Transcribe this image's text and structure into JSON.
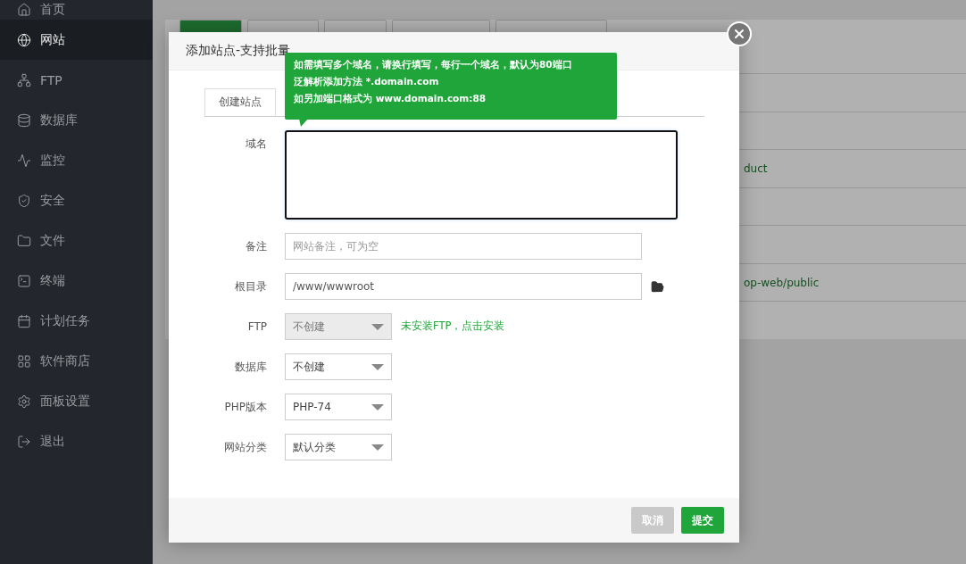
{
  "sidebar": {
    "items": [
      {
        "label": "首页",
        "selected": false
      },
      {
        "label": "网站",
        "selected": true
      },
      {
        "label": "FTP",
        "selected": false
      },
      {
        "label": "数据库",
        "selected": false
      },
      {
        "label": "监控",
        "selected": false
      },
      {
        "label": "安全",
        "selected": false
      },
      {
        "label": "文件",
        "selected": false
      },
      {
        "label": "终端",
        "selected": false
      },
      {
        "label": "计划任务",
        "selected": false
      },
      {
        "label": "软件商店",
        "selected": false
      },
      {
        "label": "面板设置",
        "selected": false
      },
      {
        "label": "退出",
        "selected": false
      }
    ]
  },
  "background_table": {
    "rows": [
      "",
      "",
      "duct",
      "",
      "",
      "op-web/public",
      ""
    ]
  },
  "dialog": {
    "title": "添加站点-支持批量",
    "tabs": [
      {
        "label": "创建站点",
        "selected": true
      }
    ],
    "tooltip": [
      "如需填写多个域名，请换行填写，每行一个域名，默认为80端口",
      "泛解析添加方法 *.domain.com",
      "如另加端口格式为 www.domain.com:88"
    ],
    "fields": [
      {
        "kind": "textarea",
        "label": "域名"
      },
      {
        "kind": "input",
        "label": "备注",
        "placeholder": "网站备注，可为空"
      },
      {
        "kind": "input",
        "label": "根目录",
        "value": "/www/wwwroot",
        "browse": true
      },
      {
        "kind": "select",
        "label": "FTP",
        "value": "不创建",
        "disabled": true,
        "note": "未安装FTP，点击安装"
      },
      {
        "kind": "select",
        "label": "数据库",
        "value": "不创建",
        "disabled": false
      },
      {
        "kind": "select",
        "label": "PHP版本",
        "value": "PHP-74",
        "disabled": false
      },
      {
        "kind": "select",
        "label": "网站分类",
        "value": "默认分类",
        "disabled": false
      }
    ],
    "buttons": [
      {
        "label": "取消",
        "kind": "cancel"
      },
      {
        "label": "提交",
        "kind": "submit"
      }
    ]
  }
}
